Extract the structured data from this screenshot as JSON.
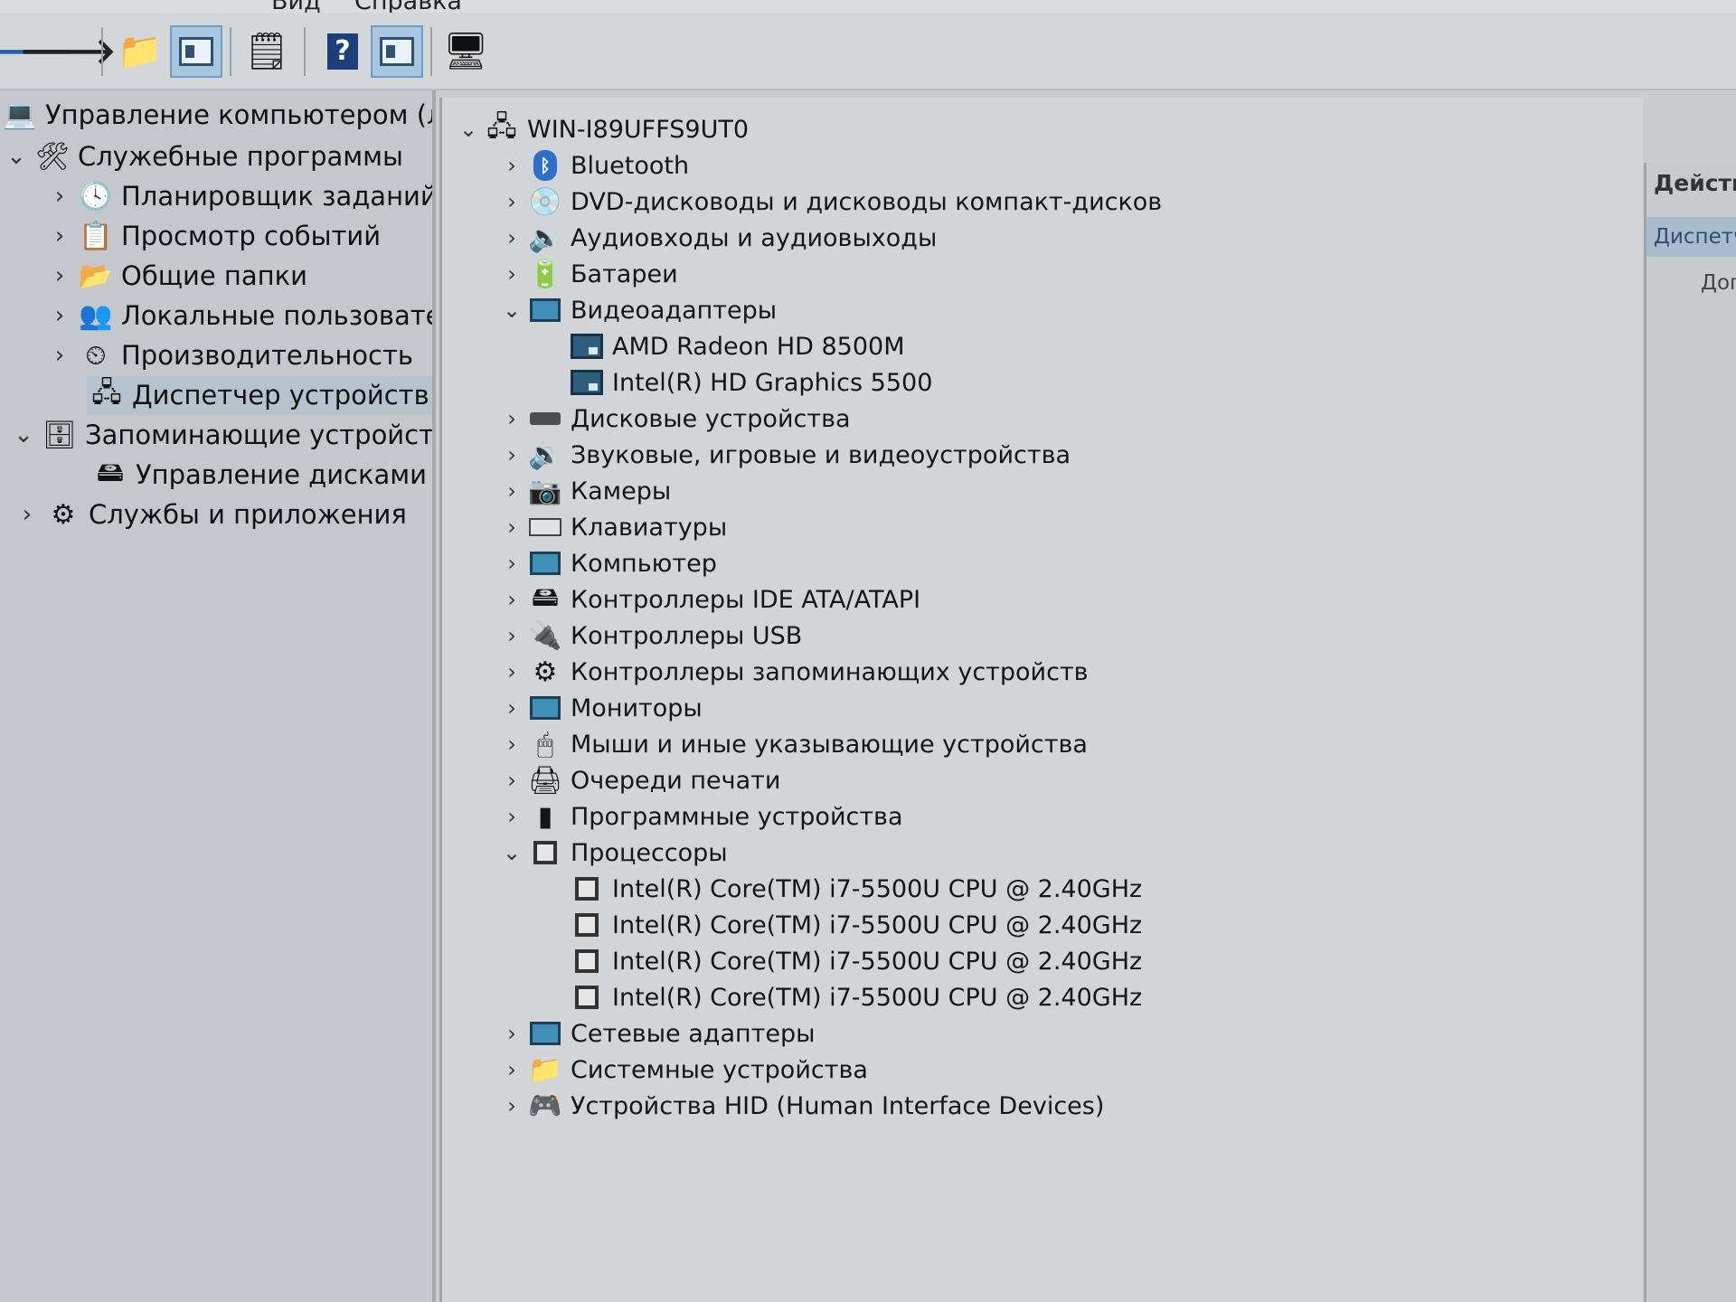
{
  "menu": {
    "view": "Вид",
    "help": "Справка"
  },
  "toolbar": {
    "back": "back-arrow-icon",
    "forward": "forward-arrow-icon"
  },
  "left_tree": [
    {
      "label": "Управление компьютером (л",
      "icon": "computer-management-icon",
      "chevron": ""
    },
    {
      "label": "Служебные программы",
      "icon": "tools-icon",
      "chevron": "⌄"
    },
    {
      "label": "Планировщик заданий",
      "icon": "clock-icon",
      "chevron": "›"
    },
    {
      "label": "Просмотр событий",
      "icon": "event-viewer-icon",
      "chevron": "›"
    },
    {
      "label": "Общие папки",
      "icon": "shared-folder-icon",
      "chevron": "›"
    },
    {
      "label": "Локальные пользовате",
      "icon": "users-icon",
      "chevron": "›"
    },
    {
      "label": "Производительность",
      "icon": "performance-icon",
      "chevron": "›"
    },
    {
      "label": "Диспетчер устройств",
      "icon": "device-manager-icon",
      "chevron": ""
    },
    {
      "label": "Запоминающие устройст",
      "icon": "storage-icon",
      "chevron": "⌄"
    },
    {
      "label": "Управление дисками",
      "icon": "disk-management-icon",
      "chevron": ""
    },
    {
      "label": "Службы и приложения",
      "icon": "services-icon",
      "chevron": "›"
    }
  ],
  "device_tree": {
    "root": "WIN-I89UFFS9UT0",
    "rows": [
      {
        "label": "Bluetooth",
        "chevron": "›",
        "icon": "bluetooth-icon"
      },
      {
        "label": "DVD-дисководы и дисководы компакт-дисков",
        "chevron": "›",
        "icon": "dvd-drive-icon"
      },
      {
        "label": "Аудиовходы и аудиовыходы",
        "chevron": "›",
        "icon": "speaker-icon"
      },
      {
        "label": "Батареи",
        "chevron": "›",
        "icon": "battery-icon"
      },
      {
        "label": "Видеоадаптеры",
        "chevron": "⌄",
        "icon": "display-adapter-icon"
      },
      {
        "label": "AMD Radeon HD 8500M",
        "chevron": "",
        "icon": "gpu-icon",
        "child": true
      },
      {
        "label": "Intel(R) HD Graphics 5500",
        "chevron": "",
        "icon": "gpu-icon",
        "child": true
      },
      {
        "label": "Дисковые устройства",
        "chevron": "›",
        "icon": "disk-drive-icon"
      },
      {
        "label": "Звуковые, игровые и видеоустройства",
        "chevron": "›",
        "icon": "sound-icon"
      },
      {
        "label": "Камеры",
        "chevron": "›",
        "icon": "camera-icon"
      },
      {
        "label": "Клавиатуры",
        "chevron": "›",
        "icon": "keyboard-icon"
      },
      {
        "label": "Компьютер",
        "chevron": "›",
        "icon": "computer-icon"
      },
      {
        "label": "Контроллеры IDE ATA/ATAPI",
        "chevron": "›",
        "icon": "ide-controller-icon"
      },
      {
        "label": "Контроллеры USB",
        "chevron": "›",
        "icon": "usb-icon"
      },
      {
        "label": "Контроллеры запоминающих устройств",
        "chevron": "›",
        "icon": "storage-controller-icon"
      },
      {
        "label": "Мониторы",
        "chevron": "›",
        "icon": "monitor-icon"
      },
      {
        "label": "Мыши и иные указывающие устройства",
        "chevron": "›",
        "icon": "mouse-icon"
      },
      {
        "label": "Очереди печати",
        "chevron": "›",
        "icon": "printer-icon"
      },
      {
        "label": "Программные устройства",
        "chevron": "›",
        "icon": "software-device-icon"
      },
      {
        "label": "Процессоры",
        "chevron": "⌄",
        "icon": "processor-icon"
      },
      {
        "label": "Intel(R) Core(TM) i7-5500U CPU @ 2.40GHz",
        "chevron": "",
        "icon": "cpu-icon",
        "child": true
      },
      {
        "label": "Intel(R) Core(TM) i7-5500U CPU @ 2.40GHz",
        "chevron": "",
        "icon": "cpu-icon",
        "child": true
      },
      {
        "label": "Intel(R) Core(TM) i7-5500U CPU @ 2.40GHz",
        "chevron": "",
        "icon": "cpu-icon",
        "child": true
      },
      {
        "label": "Intel(R) Core(TM) i7-5500U CPU @ 2.40GHz",
        "chevron": "",
        "icon": "cpu-icon",
        "child": true
      },
      {
        "label": "Сетевые адаптеры",
        "chevron": "›",
        "icon": "network-adapter-icon"
      },
      {
        "label": "Системные устройства",
        "chevron": "›",
        "icon": "system-device-icon"
      },
      {
        "label": "Устройства HID (Human Interface Devices)",
        "chevron": "›",
        "icon": "hid-icon"
      }
    ]
  },
  "action_pane": {
    "title": "Действ",
    "selected": "Диспетч",
    "more": "Доп"
  }
}
